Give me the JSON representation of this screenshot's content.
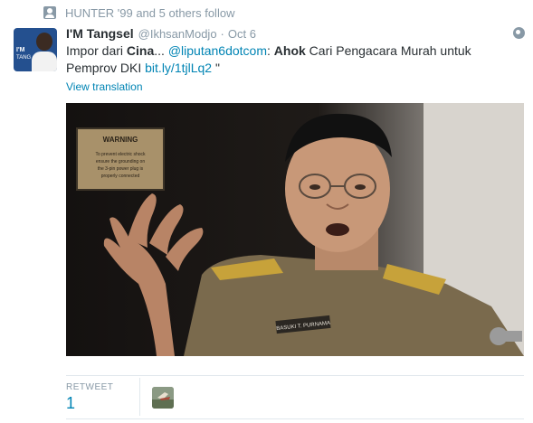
{
  "context": {
    "text": "HUNTER '99 and 5 others follow",
    "icon": "person-follow-icon"
  },
  "tweet": {
    "author": {
      "fullname": "I'M Tangsel",
      "username": "@IkhsanModjo",
      "avatar_text_1": "I'M",
      "avatar_text_2": "TANG"
    },
    "separator": "·",
    "timestamp": "Oct 6",
    "text": {
      "part1": "Impor dari ",
      "bold1": "Cina",
      "part2": "... ",
      "mention": "@liputan6dotcom",
      "part3": ": ",
      "bold2": "Ahok",
      "part4": " Cari Pengacara Murah untuk Pemprov DKI ",
      "link": "bit.ly/1tjlLq2",
      "part5": " \""
    },
    "view_translation": "View translation",
    "photo": {
      "sign_title": "WARNING",
      "sign_body": [
        "To prevent electric shock",
        "ensure the grounding on",
        "the 3-pin power plug is",
        "properly connected"
      ],
      "nametag": "BASUKI T. PURNAMA"
    }
  },
  "stats": {
    "retweet_label": "RETWEET",
    "retweet_count": "1"
  }
}
